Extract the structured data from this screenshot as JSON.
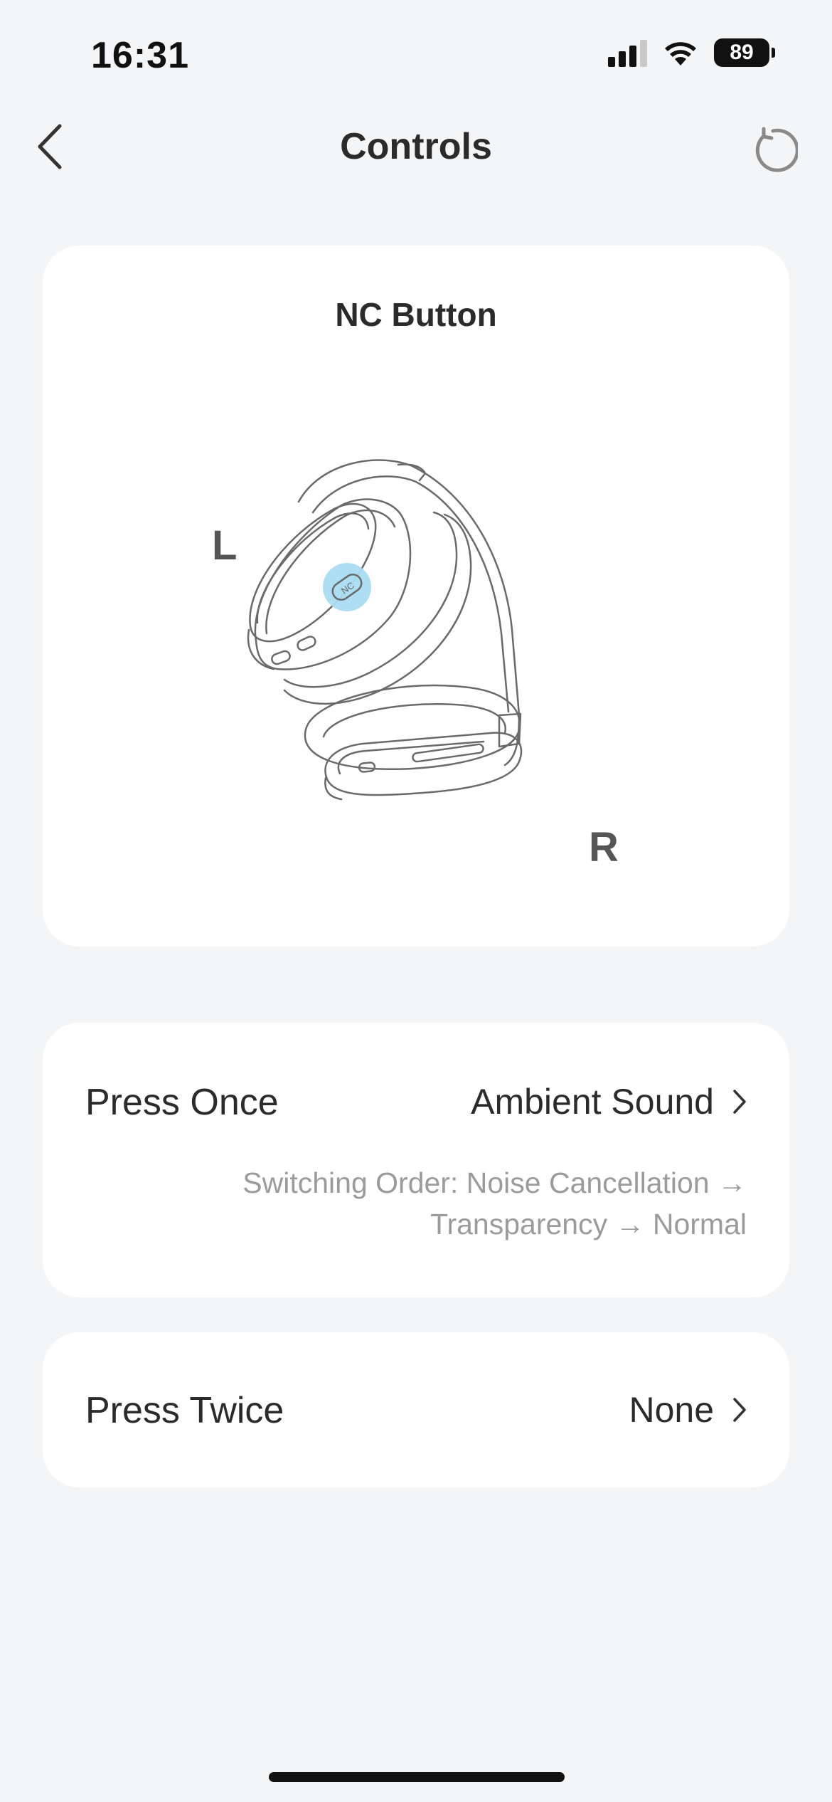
{
  "status_bar": {
    "time": "16:31",
    "battery": "89",
    "icons": [
      "cellular-signal-icon",
      "wifi-icon",
      "battery-icon"
    ]
  },
  "nav": {
    "title": "Controls",
    "back_icon": "chevron-left-icon",
    "reset_icon": "reset-icon"
  },
  "illustration": {
    "title": "NC Button",
    "left_label": "L",
    "right_label": "R",
    "button_text": "NC",
    "highlight_color": "#a9dcf2"
  },
  "controls": [
    {
      "label": "Press Once",
      "value": "Ambient Sound",
      "note": "Switching Order: Noise Cancellation → Transparency → Normal"
    },
    {
      "label": "Press Twice",
      "value": "None"
    }
  ]
}
